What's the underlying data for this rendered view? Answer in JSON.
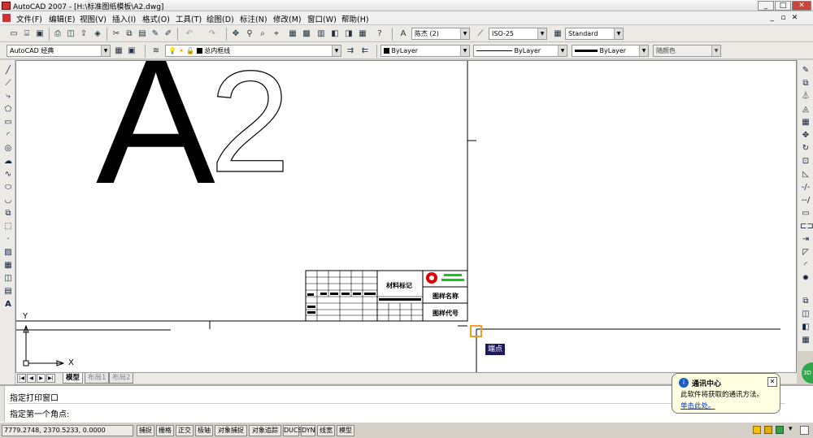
{
  "window": {
    "title": "AutoCAD 2007 - [H:\\标准图纸模板\\A2.dwg]"
  },
  "menubar": {
    "items": [
      "文件(F)",
      "编辑(E)",
      "视图(V)",
      "插入(I)",
      "格式(O)",
      "工具(T)",
      "绘图(D)",
      "标注(N)",
      "修改(M)",
      "窗口(W)",
      "帮助(H)"
    ]
  },
  "toolbar1": {
    "text_style": "陈杰 (2)",
    "dim_style": "ISO-25",
    "table_style": "Standard"
  },
  "toolbar2": {
    "workspace": "AutoCAD 经典",
    "layer": "总内框线",
    "color": "ByLayer",
    "linetype": "ByLayer",
    "lineweight": "ByLayer",
    "plotstyle": "随颜色"
  },
  "drawing": {
    "big_letter": "A",
    "big_number": "2",
    "ucs": {
      "x_label": "X",
      "y_label": "Y"
    },
    "titleblock": {
      "material": "材料标记",
      "drawing_name": "图样名称",
      "drawing_code": "图样代号"
    },
    "snap_tooltip": "端点"
  },
  "layout_tabs": [
    "模型",
    "布局1",
    "布局2"
  ],
  "command": {
    "line1": "指定打印窗口",
    "line2": "指定第一个角点:"
  },
  "status": {
    "coords": "7779.2748, 2370.5233, 0.0000",
    "buttons": [
      "捕捉",
      "栅格",
      "正交",
      "极轴",
      "对象捕捉",
      "对象追踪",
      "DUCS",
      "DYN",
      "线宽",
      "模型"
    ]
  },
  "balloon": {
    "title": "通讯中心",
    "body": "此软件将获取的通讯方法。",
    "link": "单击此处。"
  },
  "colors": {
    "snap": "#f39c2b",
    "tooltip_bg": "#1d1a5c",
    "stamp": "#e00000",
    "stamp_text": "#14c814"
  }
}
